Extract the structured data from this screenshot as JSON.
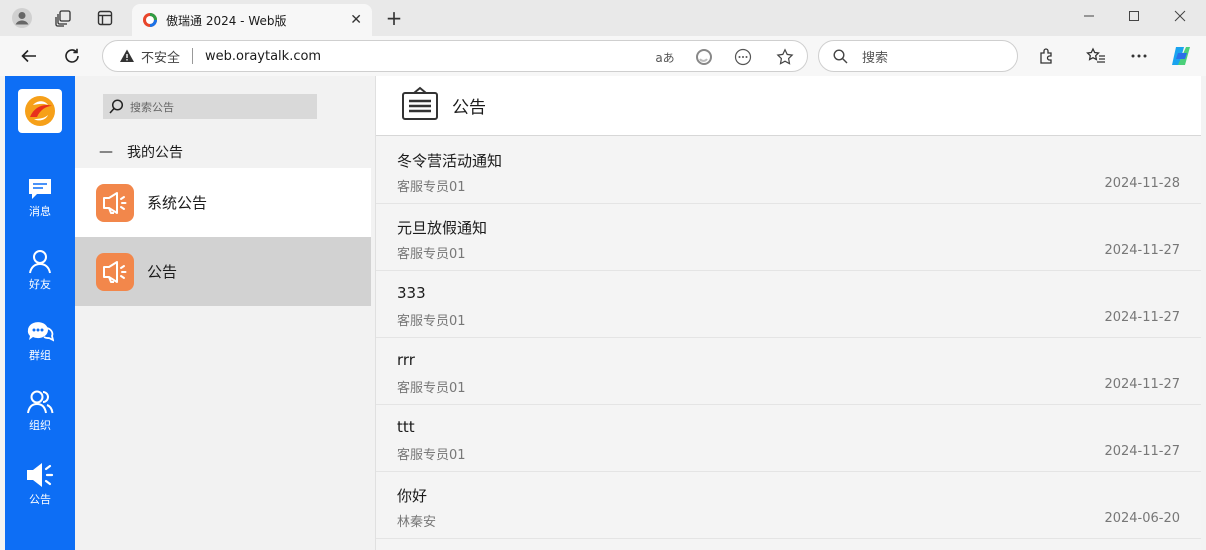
{
  "browser": {
    "tab_title": "傲瑞通 2024 - Web版",
    "security_label": "不安全",
    "url": "web.oraytalk.com",
    "read_aloud_label": "aあ",
    "search_placeholder": "搜索"
  },
  "rail": {
    "items": [
      {
        "label": "消息",
        "icon": "message-icon"
      },
      {
        "label": "好友",
        "icon": "person-icon"
      },
      {
        "label": "群组",
        "icon": "group-chat-icon"
      },
      {
        "label": "组织",
        "icon": "organization-icon"
      },
      {
        "label": "公告",
        "icon": "megaphone-icon",
        "active": true
      }
    ]
  },
  "list_panel": {
    "search_placeholder": "搜索公告",
    "group_dash": "—",
    "group_label": "我的公告",
    "items": [
      {
        "label": "系统公告"
      },
      {
        "label": "公告",
        "selected": true
      }
    ]
  },
  "content": {
    "title": "公告",
    "notices": [
      {
        "title": "冬令营活动通知",
        "author": "客服专员01",
        "date": "2024-11-28"
      },
      {
        "title": "元旦放假通知",
        "author": "客服专员01",
        "date": "2024-11-27"
      },
      {
        "title": "333",
        "author": "客服专员01",
        "date": "2024-11-27"
      },
      {
        "title": "rrr",
        "author": "客服专员01",
        "date": "2024-11-27"
      },
      {
        "title": "ttt",
        "author": "客服专员01",
        "date": "2024-11-27"
      },
      {
        "title": "你好",
        "author": "林秦安",
        "date": "2024-06-20"
      }
    ]
  },
  "colors": {
    "rail": "#0d6ef5",
    "notice_icon": "#f2874b",
    "selected_row": "#d2d2d2"
  }
}
